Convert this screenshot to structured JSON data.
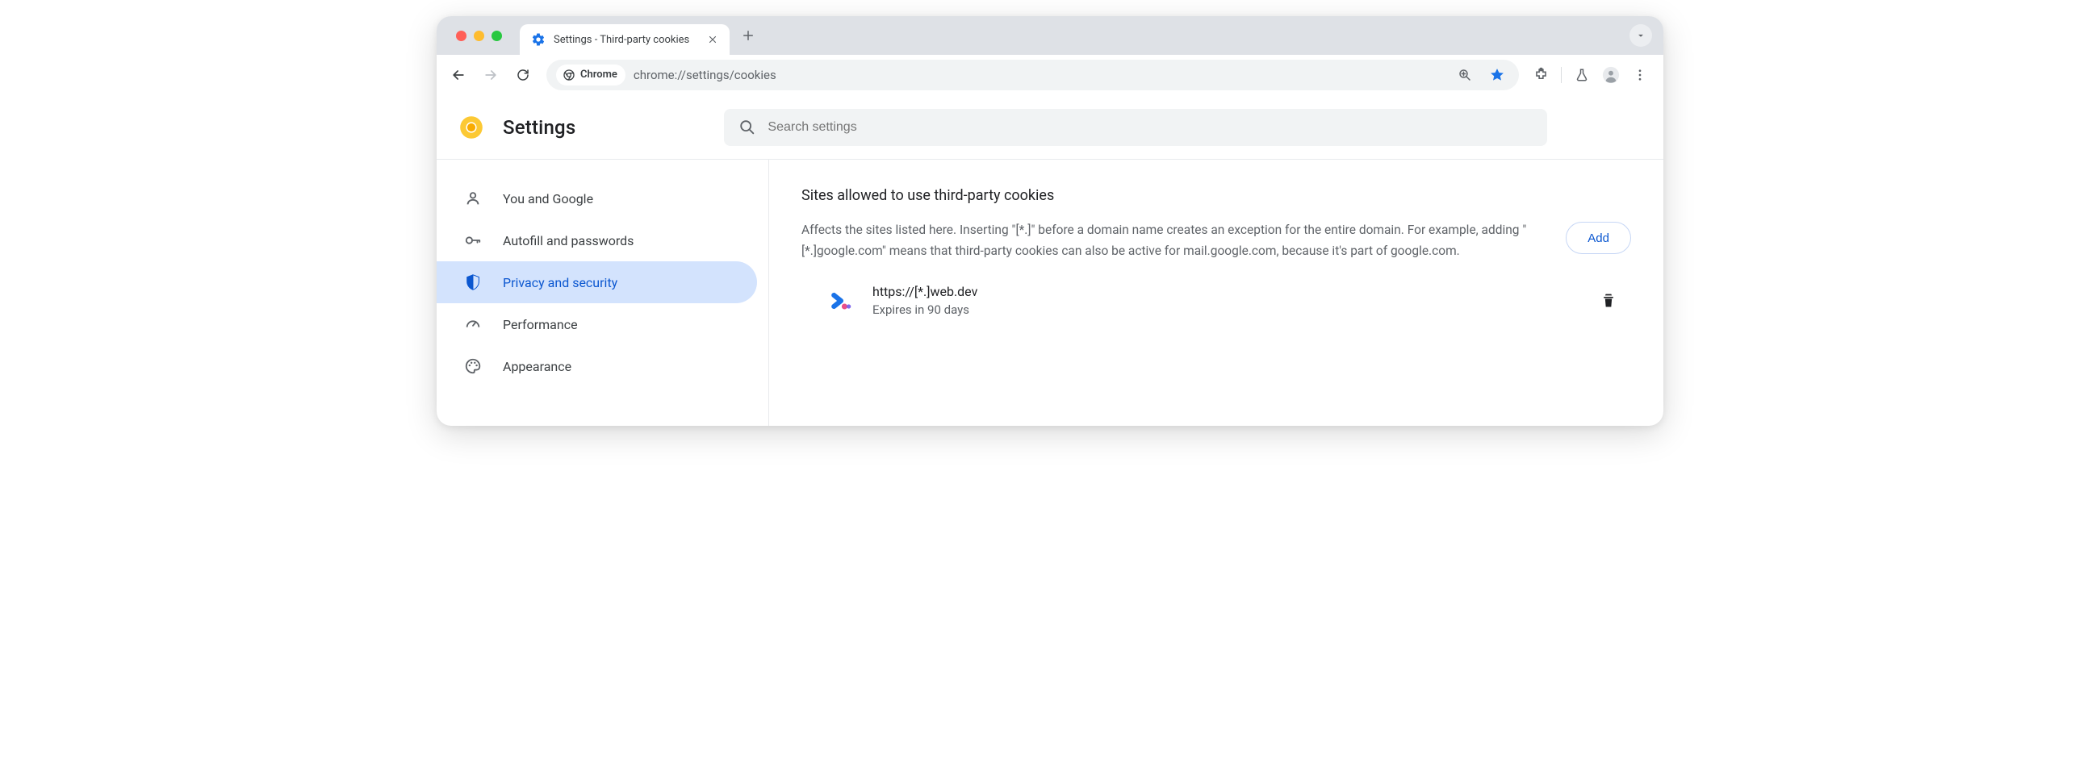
{
  "browser": {
    "tab_title": "Settings - Third-party cookies",
    "url": "chrome://settings/cookies",
    "site_chip_label": "Chrome"
  },
  "header": {
    "app_title": "Settings",
    "search_placeholder": "Search settings"
  },
  "sidebar": {
    "items": [
      {
        "label": "You and Google"
      },
      {
        "label": "Autofill and passwords"
      },
      {
        "label": "Privacy and security"
      },
      {
        "label": "Performance"
      },
      {
        "label": "Appearance"
      }
    ],
    "active_index": 2
  },
  "main": {
    "section_title": "Sites allowed to use third-party cookies",
    "section_desc": "Affects the sites listed here. Inserting \"[*.]\" before a domain name creates an exception for the entire domain. For example, adding \"[*.]google.com\" means that third-party cookies can also be active for mail.google.com, because it's part of google.com.",
    "add_label": "Add",
    "site": {
      "url": "https://[*.]web.dev",
      "expiry": "Expires in 90 days"
    }
  }
}
